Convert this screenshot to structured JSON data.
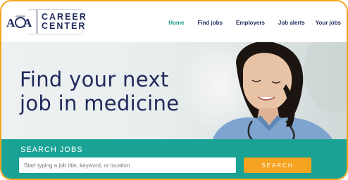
{
  "header": {
    "logo_text_line1": "CAREER",
    "logo_text_line2": "CENTER",
    "nav": [
      {
        "label": "Home",
        "active": true
      },
      {
        "label": "Find jobs",
        "active": false
      },
      {
        "label": "Employers",
        "active": false
      },
      {
        "label": "Job alerts",
        "active": false
      },
      {
        "label": "Your jobs",
        "active": false
      }
    ]
  },
  "hero": {
    "title_line1": "Find your next",
    "title_line2": "job in medicine"
  },
  "search": {
    "label": "SEARCH JOBS",
    "placeholder": "Start typing a job title, keyword, or location",
    "button_label": "SEARCH"
  },
  "colors": {
    "accent_teal": "#1aa395",
    "accent_orange": "#f5a320",
    "navy": "#1f2a5c",
    "frame_border": "#f2a61f"
  }
}
